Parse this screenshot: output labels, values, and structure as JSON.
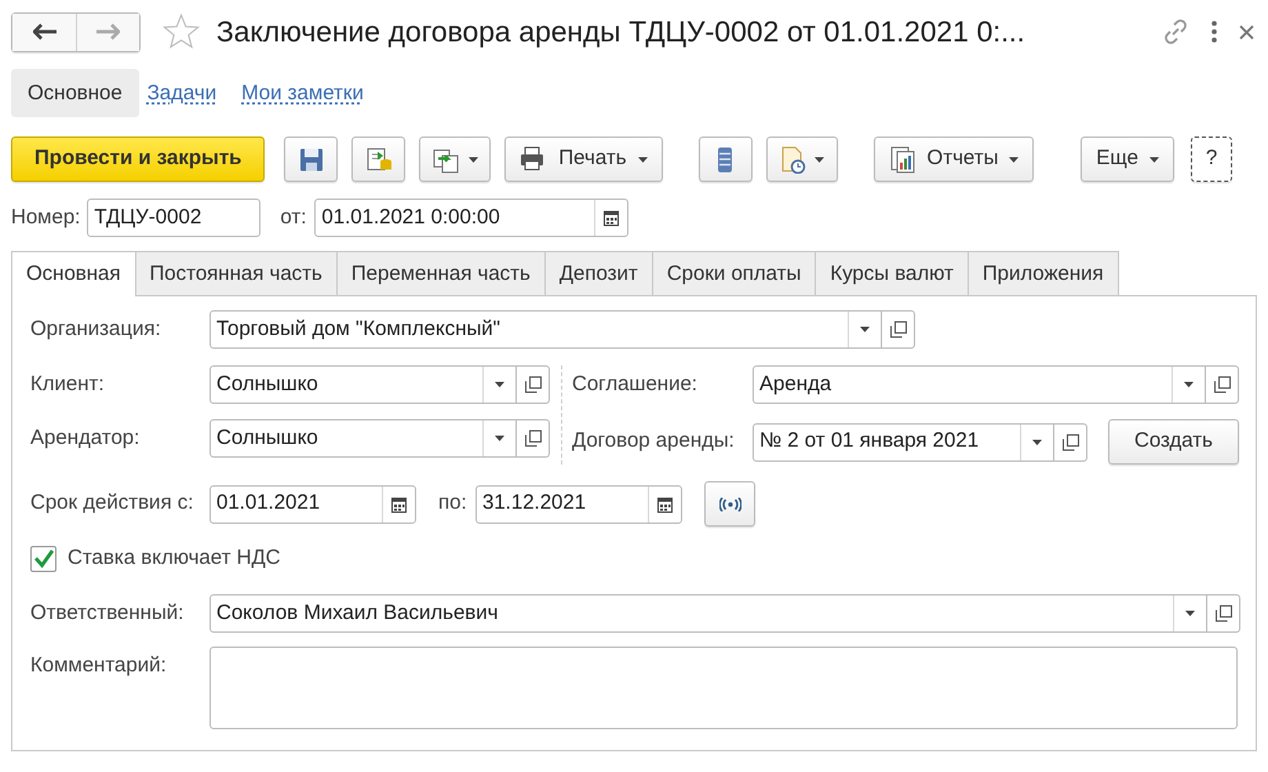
{
  "window": {
    "title": "Заключение договора аренды ТДЦУ-0002 от 01.01.2021 0:...",
    "favorite": false
  },
  "sections": [
    {
      "label": "Основное",
      "selected": true
    },
    {
      "label": "Задачи",
      "selected": false
    },
    {
      "label": "Мои заметки",
      "selected": false
    }
  ],
  "toolbar": [
    {
      "kind": "primary",
      "label": "Провести и закрыть"
    },
    {
      "kind": "icon",
      "dropdown": false
    },
    {
      "kind": "icon",
      "dropdown": false
    },
    {
      "kind": "icon",
      "dropdown": true
    },
    {
      "kind": "text",
      "label": "Печать",
      "dropdown": true
    },
    {
      "kind": "icon",
      "dropdown": false
    },
    {
      "kind": "icon",
      "dropdown": true
    },
    {
      "kind": "text",
      "label": "Отчеты",
      "dropdown": true
    },
    {
      "kind": "text",
      "label": "Еще",
      "dropdown": true
    },
    {
      "kind": "help",
      "label": "?"
    }
  ],
  "number": {
    "label": "Номер:",
    "value": "ТДЦУ-0002"
  },
  "date": {
    "label": "от:",
    "value": "01.01.2021  0:00:00"
  },
  "tabs": [
    {
      "label": "Основная",
      "selected": true
    },
    {
      "label": "Постоянная часть",
      "selected": false
    },
    {
      "label": "Переменная часть",
      "selected": false
    },
    {
      "label": "Депозит",
      "selected": false
    },
    {
      "label": "Сроки оплаты",
      "selected": false
    },
    {
      "label": "Курсы валют",
      "selected": false
    },
    {
      "label": "Приложения",
      "selected": false
    }
  ],
  "form": {
    "organization": {
      "label": "Организация:",
      "value": "Торговый дом \"Комплексный\""
    },
    "client": {
      "label": "Клиент:",
      "value": "Солнышко"
    },
    "agreement": {
      "label": "Соглашение:",
      "value": "Аренда"
    },
    "tenant": {
      "label": "Арендатор:",
      "value": "Солнышко"
    },
    "contract": {
      "label": "Договор аренды:",
      "value": "№ 2 от 01 января 2021"
    },
    "create_button": "Создать",
    "period": {
      "label": "Срок действия с:",
      "from": "01.01.2021",
      "to_label": "по:",
      "to": "31.12.2021"
    },
    "vat_included": {
      "label": "Ставка включает НДС",
      "checked": true
    },
    "responsible": {
      "label": "Ответственный:",
      "value": "Соколов Михаил Васильевич"
    },
    "comment": {
      "label": "Комментарий:"
    }
  }
}
